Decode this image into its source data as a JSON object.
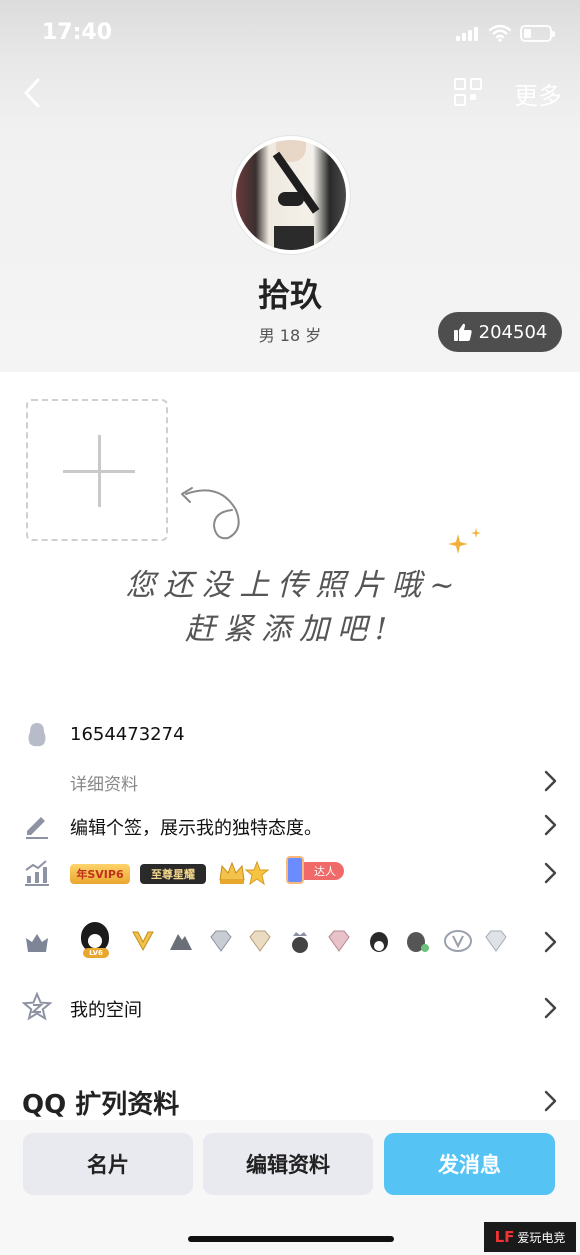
{
  "status_bar": {
    "time": "17:40"
  },
  "nav": {
    "more_label": "更多"
  },
  "profile": {
    "nickname": "拾玖",
    "gender_age": "男  18 岁",
    "likes": "204504"
  },
  "photo_hint": {
    "line1": "您还没上传照片哦~",
    "line2": "赶紧添加吧!"
  },
  "info": {
    "qq_number": "1654473274",
    "details_label": "详细资料",
    "signature_placeholder": "编辑个签，展示我的独特态度。",
    "vip_badges": [
      "年SVIP6",
      "至尊星耀"
    ],
    "daren_label": "达人",
    "level_label": "LV6",
    "space_label": "我的空间"
  },
  "extended": {
    "title": "QQ 扩列资料"
  },
  "actions": {
    "card": "名片",
    "edit": "编辑资料",
    "message": "发消息"
  },
  "watermark": {
    "brand": "爱玩电竞"
  },
  "colors": {
    "primary_button": "#55c4f4",
    "like_pill": "#4e4e4e",
    "vip_gold": "#e9a72e"
  }
}
